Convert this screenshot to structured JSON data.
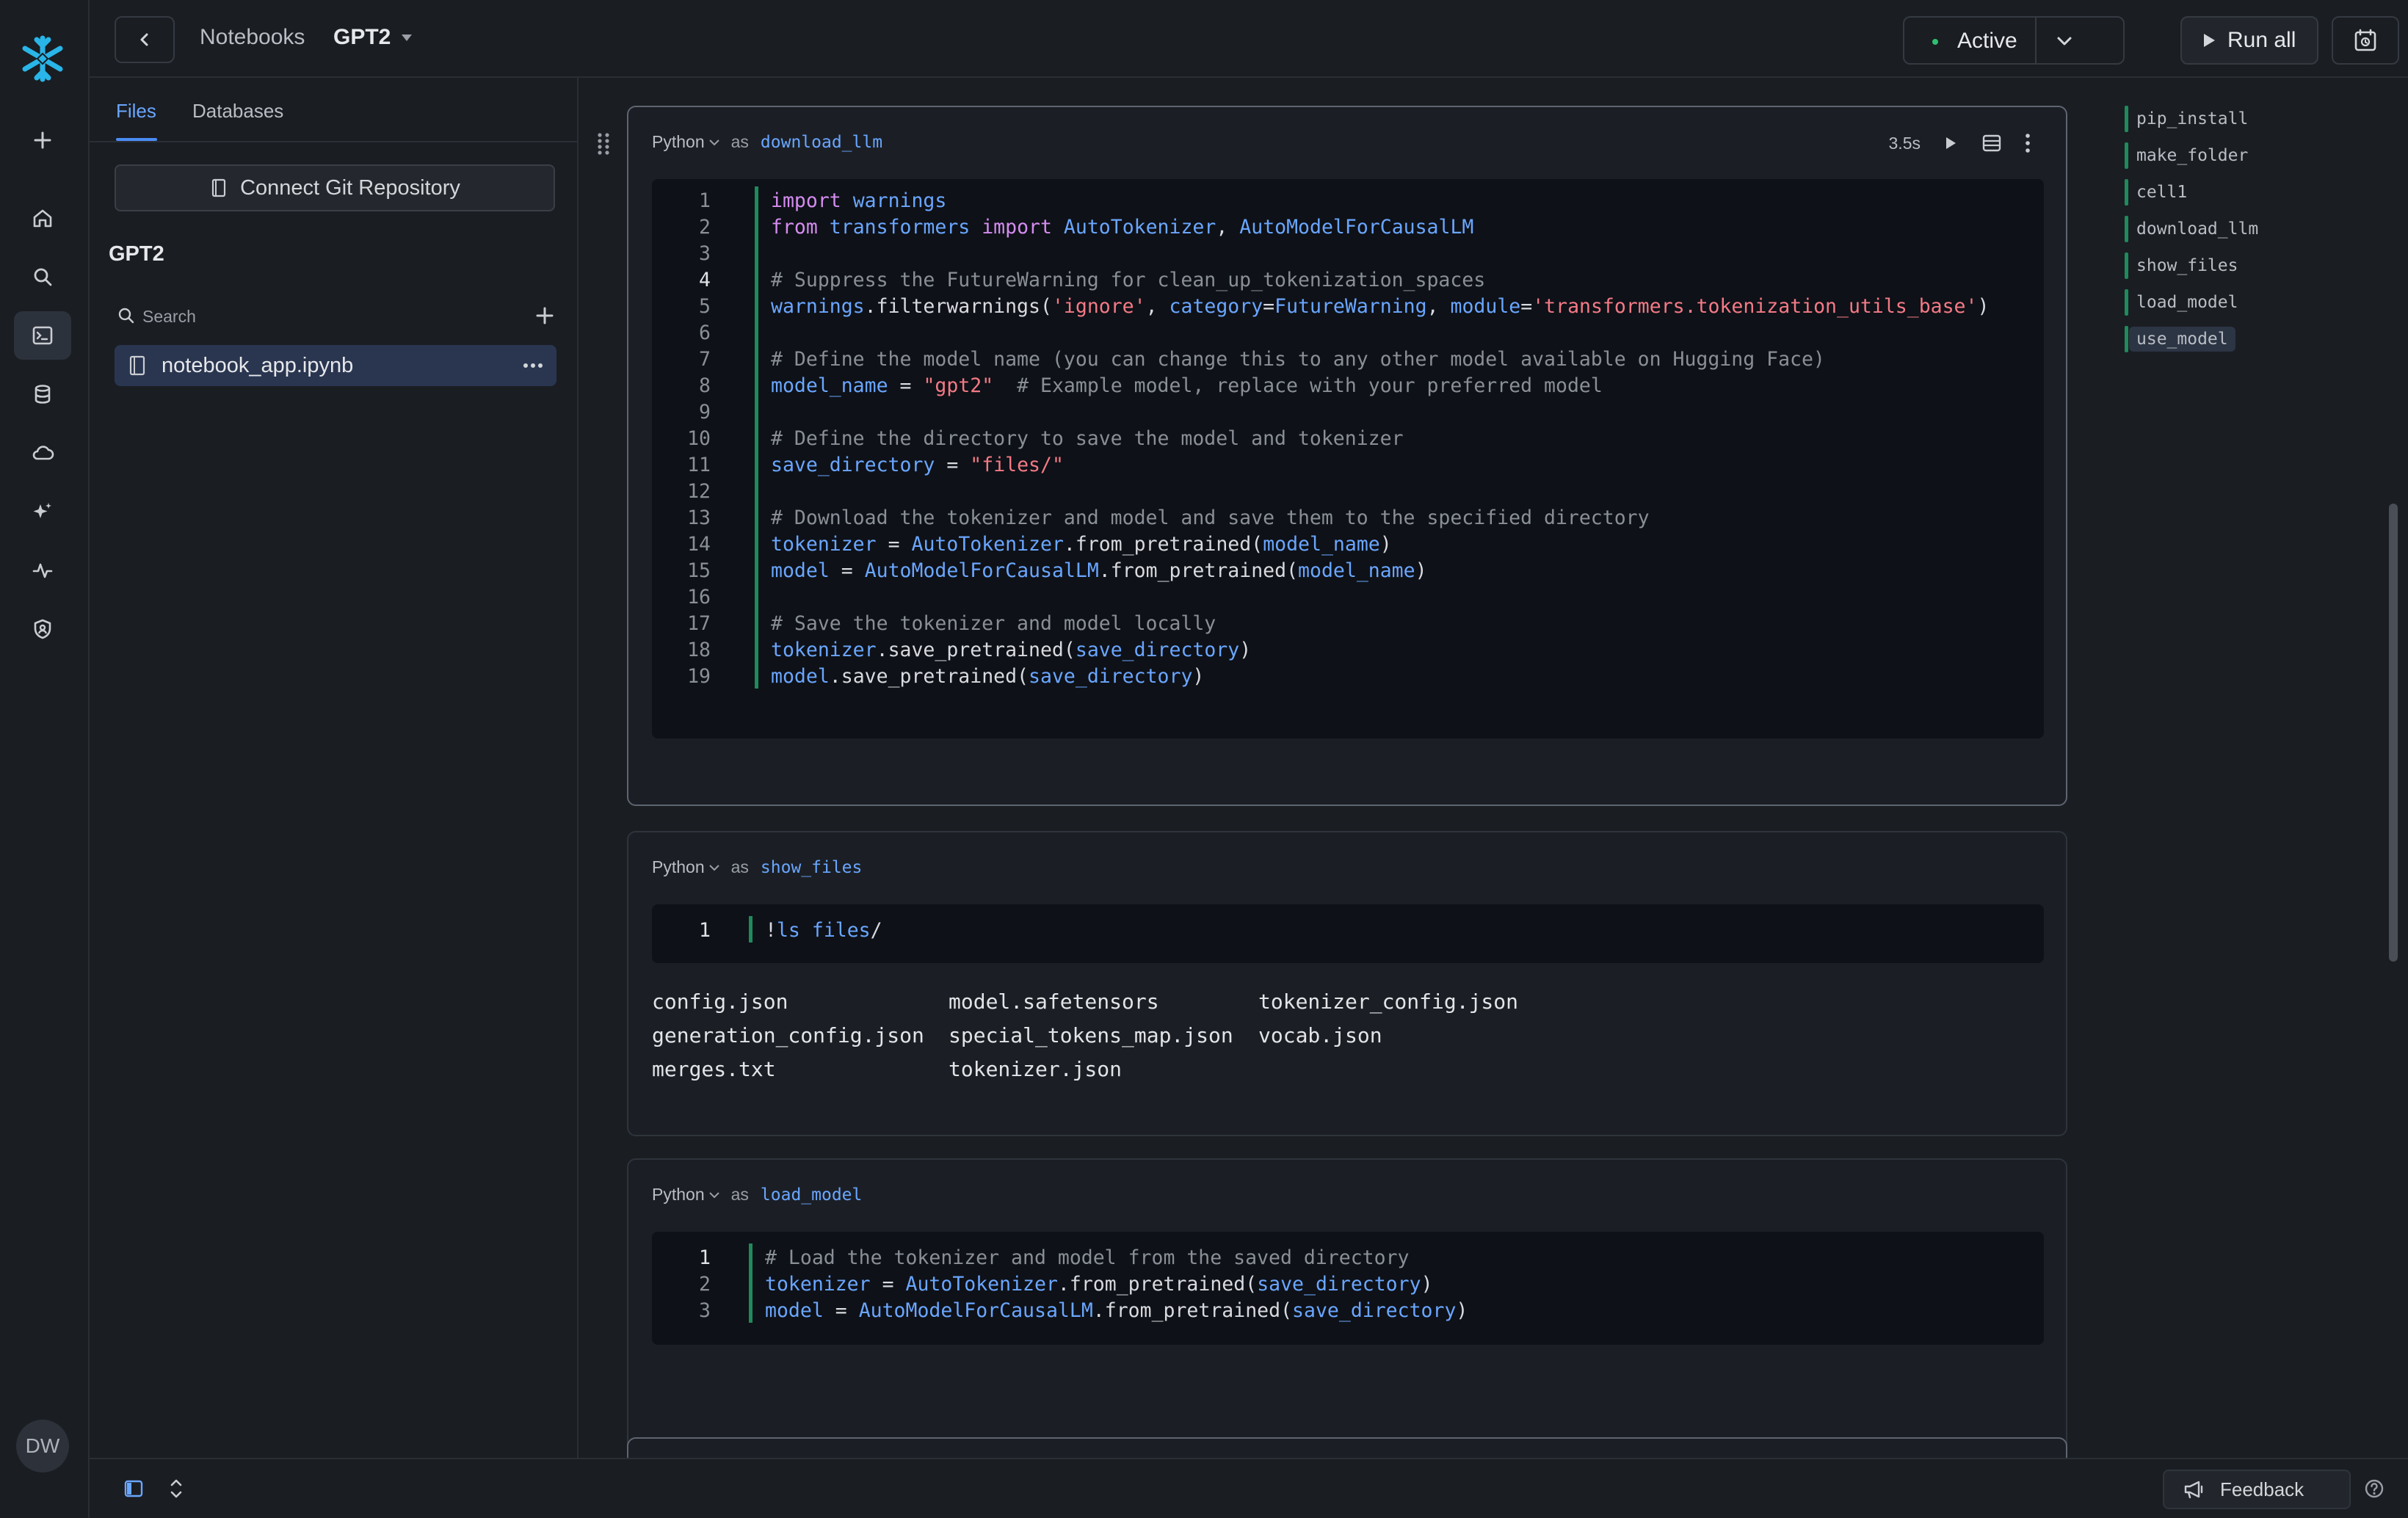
{
  "header": {
    "breadcrumb_root": "Notebooks",
    "notebook_name": "GPT2",
    "status": "Active",
    "run_all": "Run all"
  },
  "files_panel": {
    "tabs": [
      "Files",
      "Databases"
    ],
    "connect_git": "Connect Git Repository",
    "project": "GPT2",
    "search_placeholder": "Search",
    "files": [
      "notebook_app.ipynb"
    ]
  },
  "cells": [
    {
      "lang": "Python",
      "as": "as",
      "name": "download_llm",
      "duration": "3.5s",
      "lines": [
        "import warnings",
        "from transformers import AutoTokenizer, AutoModelForCausalLM",
        "",
        "# Suppress the FutureWarning for clean_up_tokenization_spaces",
        "warnings.filterwarnings('ignore', category=FutureWarning, module='transformers.tokenization_utils_base')",
        "",
        "# Define the model name (you can change this to any other model available on Hugging Face)",
        "model_name = \"gpt2\"  # Example model, replace with your preferred model",
        "",
        "# Define the directory to save the model and tokenizer",
        "save_directory = \"files/\"",
        "",
        "# Download the tokenizer and model and save them to the specified directory",
        "tokenizer = AutoTokenizer.from_pretrained(model_name)",
        "model = AutoModelForCausalLM.from_pretrained(model_name)",
        "",
        "# Save the tokenizer and model locally",
        "tokenizer.save_pretrained(save_directory)",
        "model.save_pretrained(save_directory)"
      ]
    },
    {
      "lang": "Python",
      "as": "as",
      "name": "show_files",
      "lines": [
        "!ls files/"
      ],
      "output": [
        [
          "config.json",
          "model.safetensors",
          "tokenizer_config.json"
        ],
        [
          "generation_config.json",
          "special_tokens_map.json",
          "vocab.json"
        ],
        [
          "merges.txt",
          "tokenizer.json",
          ""
        ]
      ]
    },
    {
      "lang": "Python",
      "as": "as",
      "name": "load_model",
      "lines": [
        "# Load the tokenizer and model from the saved directory",
        "tokenizer = AutoTokenizer.from_pretrained(save_directory)",
        "model = AutoModelForCausalLM.from_pretrained(save_directory)"
      ]
    }
  ],
  "outline": [
    "pip_install",
    "make_folder",
    "cell1",
    "download_llm",
    "show_files",
    "load_model",
    "use_model"
  ],
  "outline_active": "use_model",
  "user_initials": "DW",
  "footer": {
    "feedback": "Feedback"
  },
  "colors": {
    "accent": "#4a8cf5",
    "status_green": "#2fbf71",
    "cell_bar": "#1f8a5b",
    "brand": "#29b5e8"
  }
}
